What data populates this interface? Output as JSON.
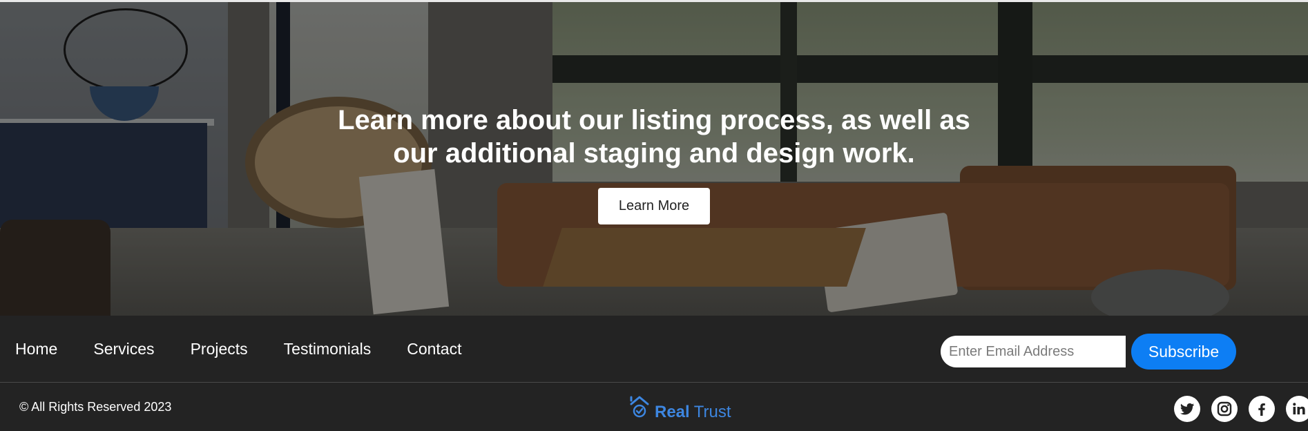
{
  "hero": {
    "title": "Learn more about our listing process, as well as our additional staging and design work.",
    "cta_label": "Learn More"
  },
  "nav": {
    "items": [
      {
        "label": "Home"
      },
      {
        "label": "Services"
      },
      {
        "label": "Projects"
      },
      {
        "label": "Testimonials"
      },
      {
        "label": "Contact"
      }
    ]
  },
  "newsletter": {
    "email_placeholder": "Enter Email Address",
    "email_value": "",
    "button_label": "Subscribe"
  },
  "footer": {
    "copyright": "© All Rights Reserved 2023",
    "brand_strong": "Real",
    "brand_light": "Trust",
    "socials": [
      "twitter-icon",
      "instagram-icon",
      "facebook-icon",
      "linkedin-icon"
    ]
  },
  "colors": {
    "accent": "#0d7ef4",
    "brand": "#3d86e0",
    "dark_bg": "#232323"
  }
}
